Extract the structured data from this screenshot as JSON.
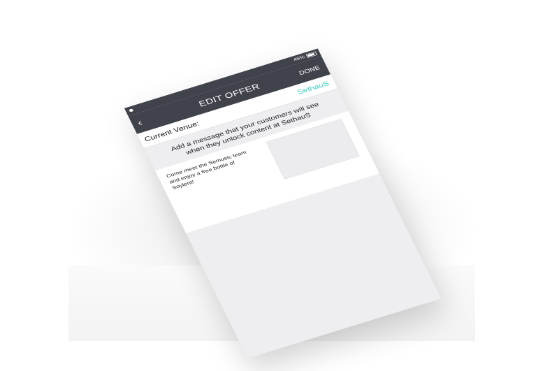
{
  "status_bar": {
    "battery_text": "46%"
  },
  "nav": {
    "back_symbol": "‹",
    "title": "EDIT OFFER",
    "done_label": "DONE"
  },
  "venue": {
    "label": "Current Venue:",
    "value": "SethauS"
  },
  "prompt": "Add a message that your customers will see when they unlock content at SethauS",
  "message": {
    "text": "Come meet the Semusic team\nand enjoy a free bottle of\nSoylent!"
  },
  "colors": {
    "header": "#41434c",
    "accent": "#39c7b6"
  }
}
